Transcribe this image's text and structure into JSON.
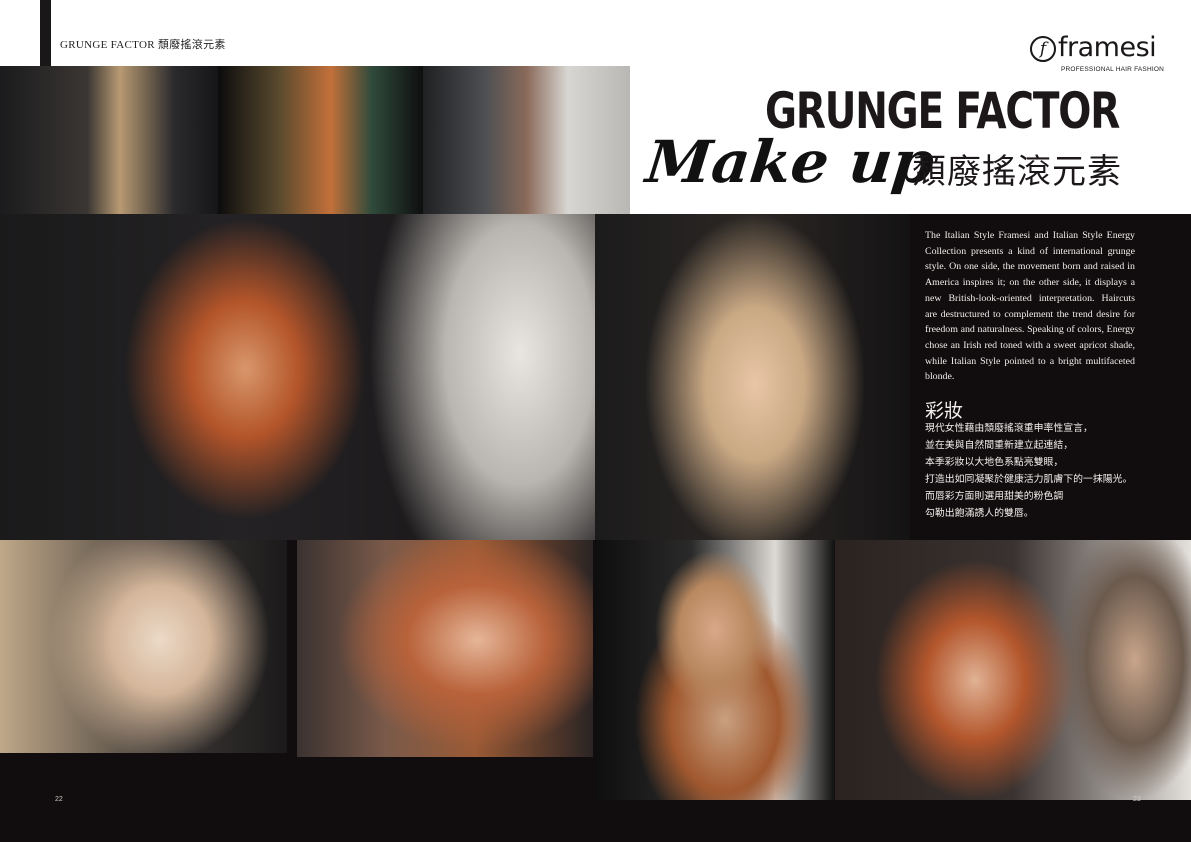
{
  "header": {
    "running_head": "GRUNGE FACTOR  頹廢搖滾元素"
  },
  "brand": {
    "logo_letter": "f",
    "name": "framesi",
    "tagline": "PROFESSIONAL HAIR FASHION"
  },
  "title": {
    "main": "GRUNGE  FACTOR",
    "script": "Make up",
    "chinese": "頹廢搖滾元素"
  },
  "article": {
    "body": "The Italian Style Framesi and Italian Style Energy Collection presents a kind of international grunge style. On one side, the movement born and raised in America inspires it; on the other side, it displays a new British-look-oriented interpretation. Haircuts are destructured to complement the trend desire for freedom and naturalness. Speaking of colors, Energy chose an Irish red toned with a sweet apricot shade, while Italian Style pointed to a bright multifaceted blonde.",
    "section_heading": "彩妝",
    "section_lines": [
      "現代女性藉由頹廢搖滾重申率性宣言，",
      "並在美與自然間重新建立起連結，",
      "本季彩妝以大地色系點亮雙眼，",
      "打造出如同凝聚於健康活力肌膚下的一抹陽光。",
      "而唇彩方面則選用甜美的粉色調",
      "勾勒出飽滿誘人的雙唇。"
    ]
  },
  "pages": {
    "left": "22",
    "right": "23"
  },
  "colors": {
    "band": "#110d0e",
    "text_dark": "#1c1819",
    "text_light": "#f2efec"
  }
}
